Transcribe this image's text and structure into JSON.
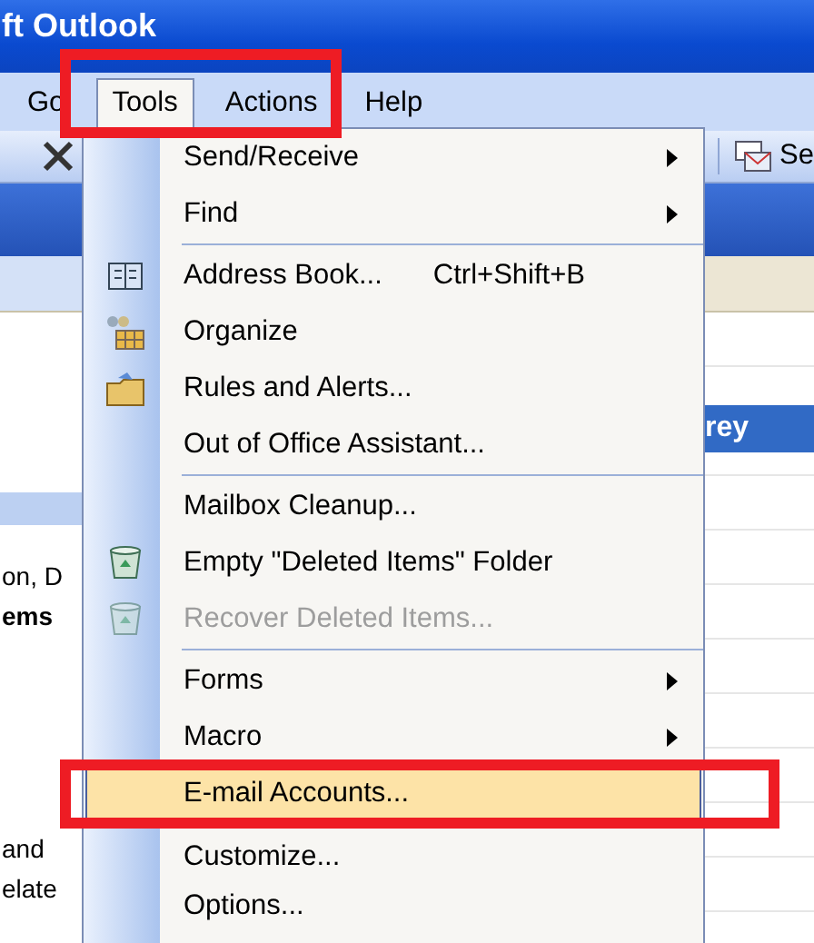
{
  "window": {
    "title": "ft Outlook"
  },
  "menu_bar": [
    {
      "label": "Go",
      "selected": false
    },
    {
      "label": "Tools",
      "selected": true
    },
    {
      "label": "Actions",
      "selected": false
    },
    {
      "label": "Help",
      "selected": false
    }
  ],
  "toolbar": {
    "button_label": "Se"
  },
  "left_pane": [
    {
      "text": "on, D",
      "bold": false
    },
    {
      "text": "ems",
      "bold": true
    },
    {
      "text": "and",
      "bold": false
    },
    {
      "text": "elate",
      "bold": false
    }
  ],
  "right_pane": {
    "selected_row": "rey"
  },
  "tools_menu": [
    {
      "kind": "submenu",
      "label": "Send/Receive",
      "disabled": false,
      "highlighted": false
    },
    {
      "kind": "submenu",
      "label": "Find",
      "disabled": false,
      "highlighted": false
    },
    {
      "kind": "separator"
    },
    {
      "kind": "command",
      "label": "Address Book...",
      "shortcut": "Ctrl+Shift+B",
      "disabled": false,
      "highlighted": false
    },
    {
      "kind": "command",
      "label": "Organize",
      "disabled": false,
      "highlighted": false
    },
    {
      "kind": "command",
      "label": "Rules and Alerts...",
      "disabled": false,
      "highlighted": false
    },
    {
      "kind": "command",
      "label": "Out of Office Assistant...",
      "disabled": false,
      "highlighted": false
    },
    {
      "kind": "separator"
    },
    {
      "kind": "command",
      "label": "Mailbox Cleanup...",
      "disabled": false,
      "highlighted": false
    },
    {
      "kind": "command",
      "label": "Empty \"Deleted Items\" Folder",
      "disabled": false,
      "highlighted": false
    },
    {
      "kind": "command",
      "label": "Recover Deleted Items...",
      "disabled": true,
      "highlighted": false
    },
    {
      "kind": "separator"
    },
    {
      "kind": "submenu",
      "label": "Forms",
      "disabled": false,
      "highlighted": false
    },
    {
      "kind": "submenu",
      "label": "Macro",
      "disabled": false,
      "highlighted": false
    },
    {
      "kind": "command",
      "label": "E-mail Accounts...",
      "disabled": false,
      "highlighted": true
    },
    {
      "kind": "command",
      "label": "Customize...",
      "disabled": false,
      "highlighted": false
    },
    {
      "kind": "command",
      "label": "Options...",
      "disabled": false,
      "highlighted": false
    }
  ],
  "callouts": [
    {
      "kind": "box"
    },
    {
      "kind": "box"
    }
  ]
}
